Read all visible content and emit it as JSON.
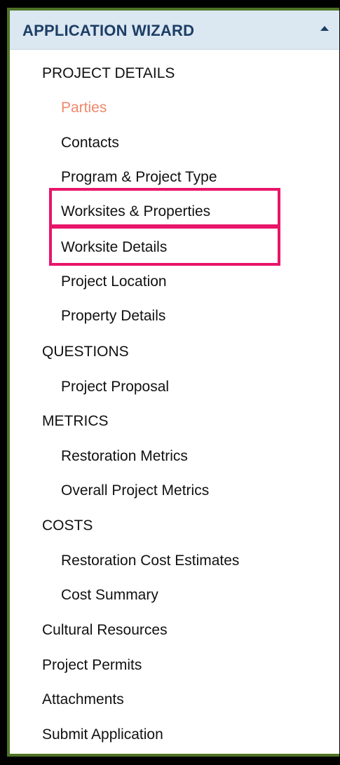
{
  "wizard": {
    "title": "APPLICATION WIZARD",
    "toggle_icon": "caret-up-icon"
  },
  "colors": {
    "border": "#4e7326",
    "header_bg": "#dbe7f1",
    "header_text": "#1c3e66",
    "active_text": "#f0886a",
    "highlight_box": "#e8156a"
  },
  "nav": {
    "project_details": {
      "heading": "PROJECT DETAILS",
      "items": [
        {
          "label": "Parties",
          "active": true
        },
        {
          "label": "Contacts"
        },
        {
          "label": "Program & Project Type"
        },
        {
          "label": "Worksites & Properties",
          "highlighted": true
        },
        {
          "label": "Worksite Details",
          "highlighted": true
        },
        {
          "label": "Project Location"
        },
        {
          "label": "Property Details"
        }
      ]
    },
    "questions": {
      "heading": "QUESTIONS",
      "items": [
        {
          "label": "Project Proposal"
        }
      ]
    },
    "metrics": {
      "heading": "METRICS",
      "items": [
        {
          "label": "Restoration Metrics"
        },
        {
          "label": "Overall Project Metrics"
        }
      ]
    },
    "costs": {
      "heading": "COSTS",
      "items": [
        {
          "label": "Restoration Cost Estimates"
        },
        {
          "label": "Cost Summary"
        }
      ]
    },
    "top_level": [
      {
        "label": "Cultural Resources"
      },
      {
        "label": "Project Permits"
      },
      {
        "label": "Attachments"
      },
      {
        "label": "Submit Application"
      }
    ]
  }
}
